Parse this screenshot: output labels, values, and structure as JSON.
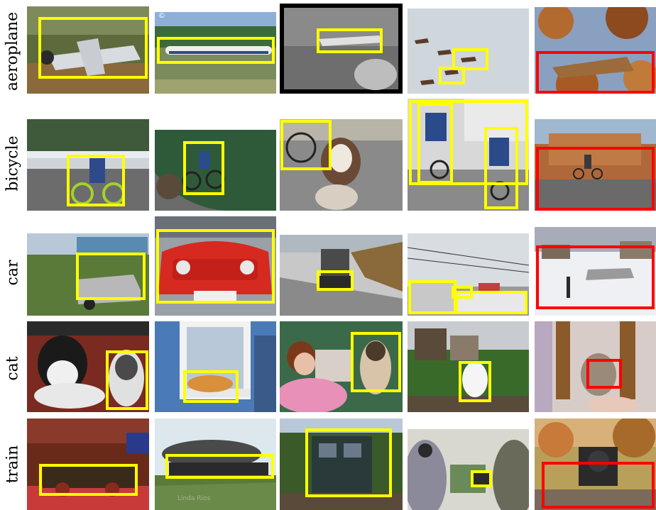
{
  "rows": [
    {
      "label": "aeroplane"
    },
    {
      "label": "bicycle"
    },
    {
      "label": "car"
    },
    {
      "label": "cat"
    },
    {
      "label": "train"
    }
  ],
  "box_colors": {
    "yellow": "#ffff00",
    "red": "#ff0000"
  },
  "icons": {
    "copyright": "©"
  },
  "watermark": "Linda Rios"
}
